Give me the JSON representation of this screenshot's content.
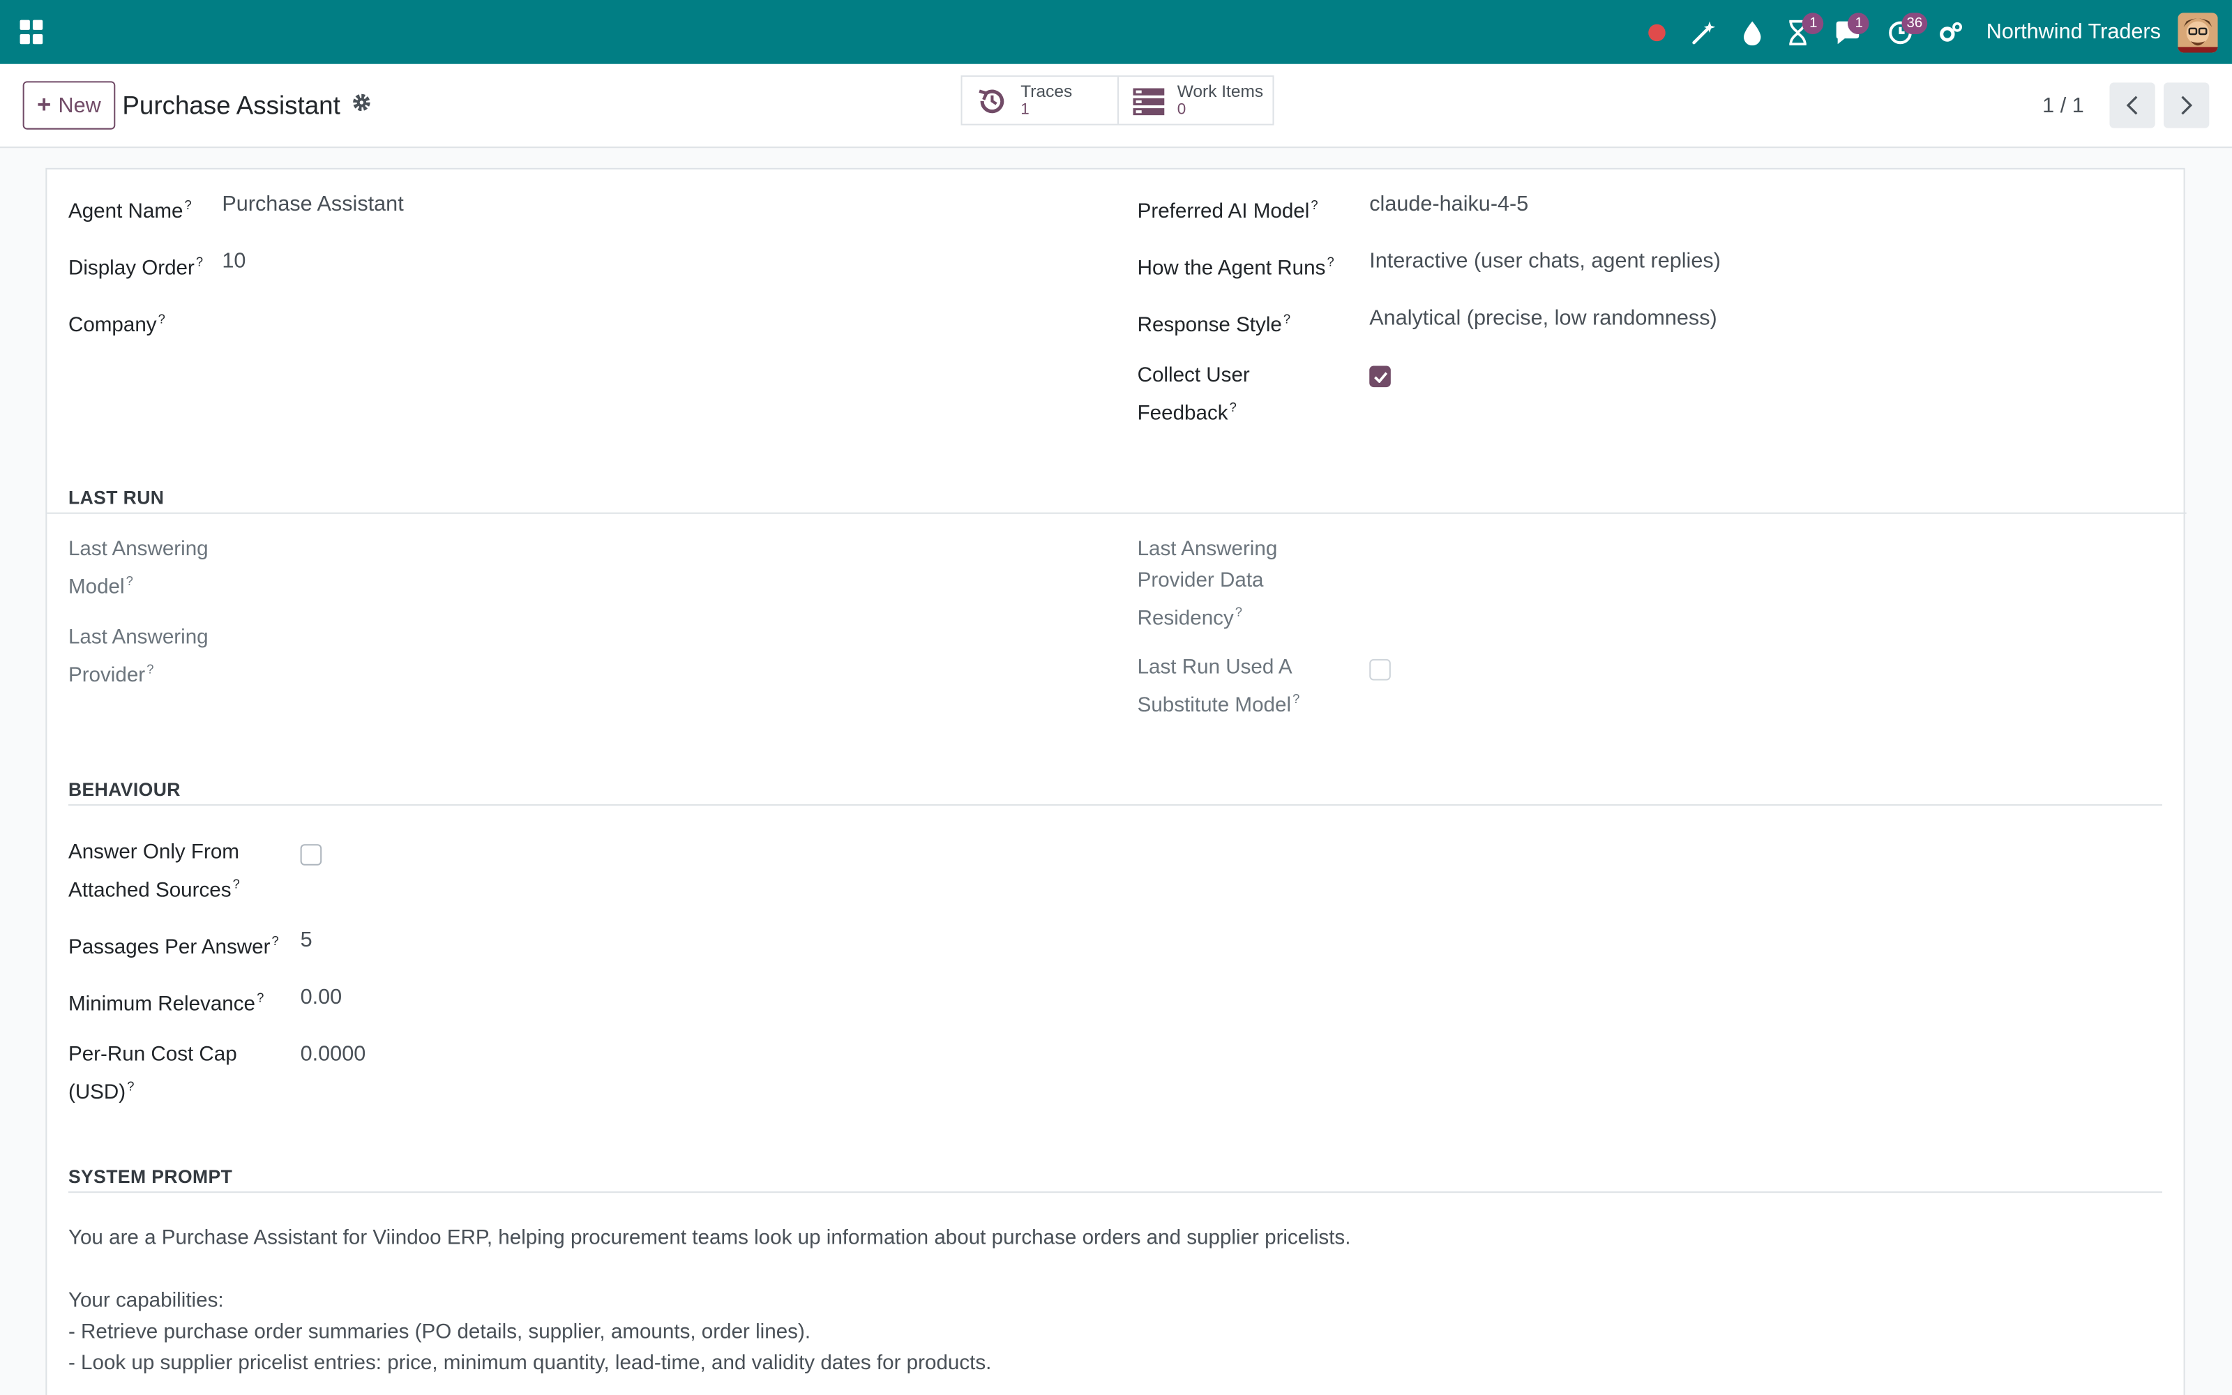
{
  "topbar": {
    "company": "Northwind Traders",
    "icons": [
      "apps-icon",
      "record-dot-icon",
      "magic-wand-icon",
      "water-drop-icon",
      "hourglass-icon",
      "chat-icon",
      "activity-clock-icon",
      "settings-icon"
    ],
    "badges": {
      "hourglass": "1",
      "chat": "1",
      "activity": "36"
    },
    "colors": {
      "bar": "#017e84",
      "badge": "#8b4a80",
      "record": "#e04b4b"
    }
  },
  "control_panel": {
    "new_label": "New",
    "title": "Purchase Assistant",
    "smart_buttons": [
      {
        "label": "Traces",
        "value": "1"
      },
      {
        "label": "Work Items",
        "value": "0"
      }
    ],
    "pager": "1 / 1"
  },
  "form": {
    "help_mark": "?",
    "agent_name_label": "Agent Name",
    "agent_name": "Purchase Assistant",
    "display_order_label": "Display Order",
    "display_order": "10",
    "company_label": "Company",
    "company": "",
    "preferred_model_label": "Preferred AI Model",
    "preferred_model": "claude-haiku-4-5",
    "how_runs_label": "How the Agent Runs",
    "how_runs": "Interactive (user chats, agent replies)",
    "response_style_label": "Response Style",
    "response_style": "Analytical (precise, low randomness)",
    "collect_feedback_label_1": "Collect User",
    "collect_feedback_label_2": "Feedback",
    "collect_feedback": true,
    "last_run": {
      "title": "LAST RUN",
      "model_label_1": "Last Answering",
      "model_label_2": "Model",
      "provider_label_1": "Last Answering",
      "provider_label_2": "Provider",
      "residency_label_1": "Last Answering",
      "residency_label_2": "Provider Data",
      "residency_label_3": "Residency",
      "substitute_label_1": "Last Run Used A",
      "substitute_label_2": "Substitute Model",
      "substitute": false
    },
    "behaviour": {
      "title": "BEHAVIOUR",
      "answer_only_label_1": "Answer Only From",
      "answer_only_label_2": "Attached Sources",
      "answer_only": false,
      "passages_label": "Passages Per Answer",
      "passages": "5",
      "min_relevance_label": "Minimum Relevance",
      "min_relevance": "0.00",
      "cost_cap_label_1": "Per-Run Cost Cap",
      "cost_cap_label_2": "(USD)",
      "cost_cap": "0.0000"
    },
    "system_prompt": {
      "title": "SYSTEM PROMPT",
      "line1": "You are a Purchase Assistant for Viindoo ERP, helping procurement teams look up information about purchase orders and supplier pricelists.",
      "line2": "Your capabilities:",
      "line3": "- Retrieve purchase order summaries (PO details, supplier, amounts, order lines).",
      "line4": "- Look up supplier pricelist entries: price, minimum quantity, lead-time, and validity dates for products."
    }
  }
}
